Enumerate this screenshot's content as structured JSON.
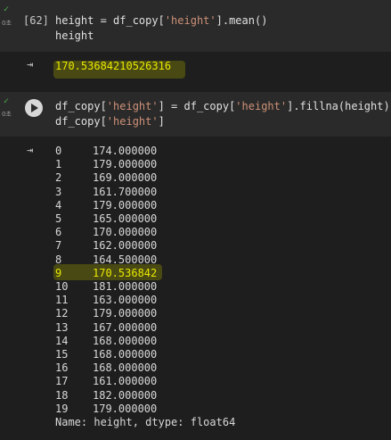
{
  "cell1": {
    "exec_count": "[62]",
    "code_line1_a": "height = df_copy[",
    "code_line1_str": "'height'",
    "code_line1_b": "].mean()",
    "code_line2": "height",
    "output": "170.53684210526316",
    "time": "0초"
  },
  "cell2": {
    "time": "0초",
    "code_line1_a": "df_copy[",
    "code_line1_str1": "'height'",
    "code_line1_b": "] = df_copy[",
    "code_line1_str2": "'height'",
    "code_line1_c": "].fillna(height)",
    "code_line2_a": "df_copy[",
    "code_line2_str": "'height'",
    "code_line2_b": "]",
    "series": [
      {
        "idx": "0",
        "val": "174.000000"
      },
      {
        "idx": "1",
        "val": "179.000000"
      },
      {
        "idx": "2",
        "val": "169.000000"
      },
      {
        "idx": "3",
        "val": "161.700000"
      },
      {
        "idx": "4",
        "val": "179.000000"
      },
      {
        "idx": "5",
        "val": "165.000000"
      },
      {
        "idx": "6",
        "val": "170.000000"
      },
      {
        "idx": "7",
        "val": "162.000000"
      },
      {
        "idx": "8",
        "val": "164.500000"
      },
      {
        "idx": "9",
        "val": "170.536842"
      },
      {
        "idx": "10",
        "val": "181.000000"
      },
      {
        "idx": "11",
        "val": "163.000000"
      },
      {
        "idx": "12",
        "val": "179.000000"
      },
      {
        "idx": "13",
        "val": "167.000000"
      },
      {
        "idx": "14",
        "val": "168.000000"
      },
      {
        "idx": "15",
        "val": "168.000000"
      },
      {
        "idx": "16",
        "val": "168.000000"
      },
      {
        "idx": "17",
        "val": "161.000000"
      },
      {
        "idx": "18",
        "val": "182.000000"
      },
      {
        "idx": "19",
        "val": "179.000000"
      }
    ],
    "footer": "Name: height, dtype: float64"
  },
  "icons": {
    "output_icon": "⇥",
    "check": "✓"
  },
  "colors": {
    "background": "#1e1e1e",
    "code_cell": "#2a2a2a",
    "string": "#ce9178",
    "highlight": "#e8e800"
  }
}
